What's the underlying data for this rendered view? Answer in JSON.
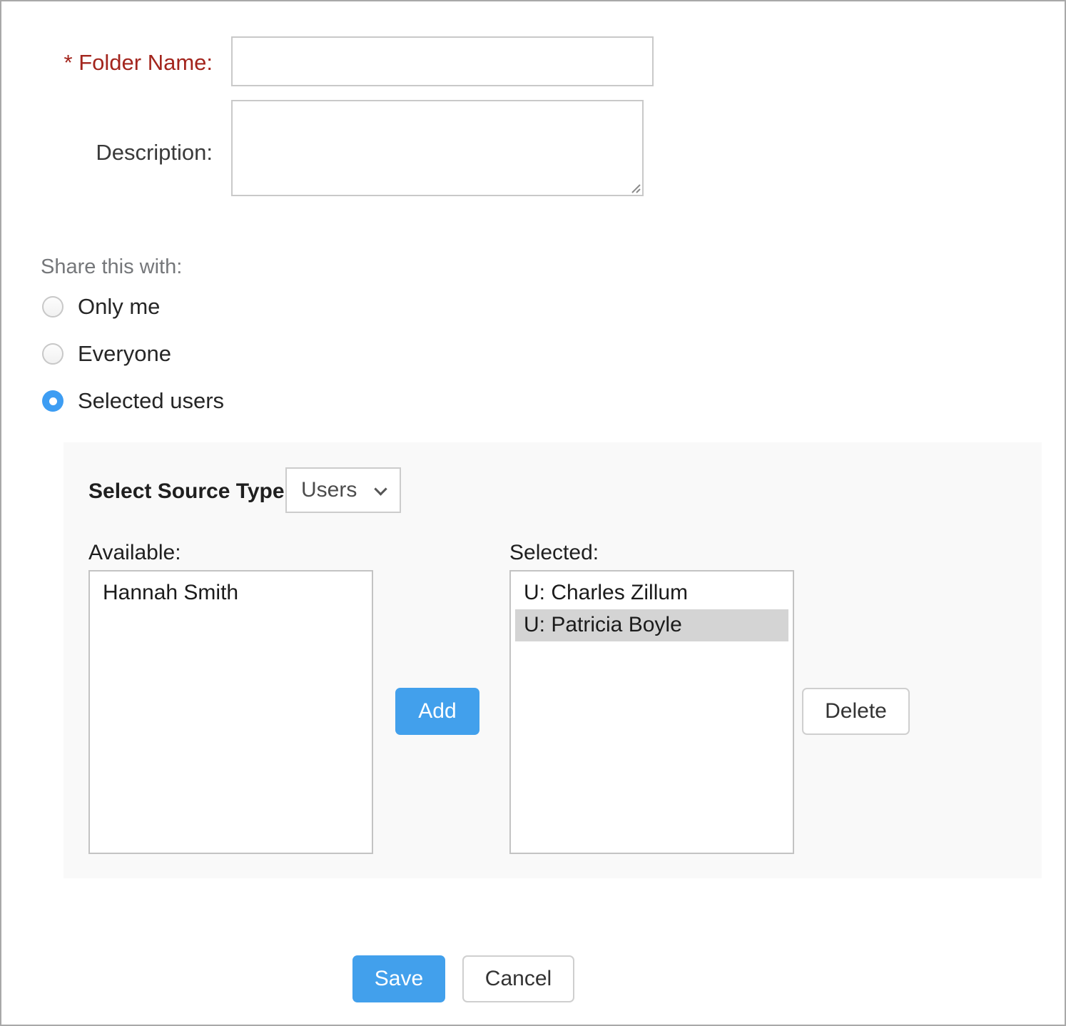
{
  "colors": {
    "accent_blue": "#42a0ec",
    "radio_selected_blue": "#3d9df3",
    "required_label_red": "#a3251d",
    "panel_background": "#f9f9f9",
    "selected_item_highlight": "#d4d4d4"
  },
  "form": {
    "folder_name": {
      "label": "* Folder Name:",
      "value": ""
    },
    "description": {
      "label": "Description:",
      "value": ""
    }
  },
  "share": {
    "heading": "Share this with:",
    "options": [
      {
        "label": "Only me",
        "selected": false
      },
      {
        "label": "Everyone",
        "selected": false
      },
      {
        "label": "Selected users",
        "selected": true
      }
    ]
  },
  "source_panel": {
    "source_type_label": "Select Source Type:",
    "source_type_value": "Users",
    "available": {
      "label": "Available:",
      "items": [
        "Hannah Smith"
      ]
    },
    "selected": {
      "label": "Selected:",
      "items": [
        {
          "text": "U: Charles Zillum",
          "highlighted": false
        },
        {
          "text": "U: Patricia Boyle",
          "highlighted": true
        }
      ]
    },
    "add_label": "Add",
    "delete_label": "Delete"
  },
  "actions": {
    "save_label": "Save",
    "cancel_label": "Cancel"
  },
  "icons": {
    "dropdown": "chevron-down-icon",
    "textarea_corner": "resize-handle-icon"
  }
}
